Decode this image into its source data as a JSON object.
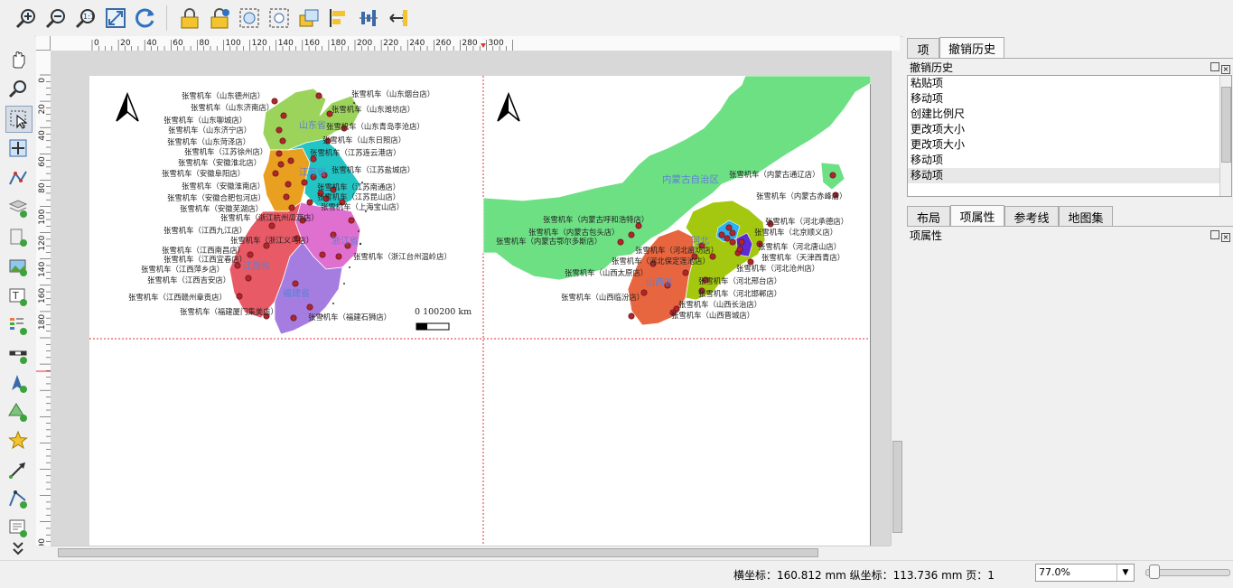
{
  "toolbar": {
    "icons": [
      "zoom-in-icon",
      "zoom-out-icon",
      "zoom-100-icon",
      "zoom-full-icon",
      "refresh-icon",
      "lock-icon",
      "unlock-icon",
      "group-icon",
      "ungroup-icon",
      "raise-icon",
      "align-icon",
      "distribute-icon",
      "resize-icon"
    ]
  },
  "lefttools": {
    "icons": [
      "pan-icon",
      "zoom-tool-icon",
      "select-icon",
      "move-content-icon",
      "edit-nodes-icon",
      "add-map-icon",
      "add-3d-map-icon",
      "add-picture-icon",
      "add-label-icon",
      "add-legend-icon",
      "add-scalebar-icon",
      "add-north-arrow-icon",
      "add-shape-icon",
      "add-marker-icon",
      "add-arrow-icon",
      "add-node-item-icon",
      "add-html-icon",
      "more-tools-icon"
    ]
  },
  "hruler": {
    "labels": [
      "0",
      "20",
      "40",
      "60",
      "80",
      "100",
      "120",
      "140",
      "160",
      "180",
      "200",
      "220",
      "240",
      "260",
      "280",
      "300"
    ]
  },
  "vruler": {
    "labels": [
      "0",
      "20",
      "40",
      "60",
      "80",
      "100",
      "120",
      "140",
      "160",
      "180",
      "190"
    ]
  },
  "maps": {
    "left": {
      "province_labels": [
        "山东省",
        "江苏省",
        "江西省",
        "浙江省",
        "福建省"
      ],
      "store_labels": [
        "张雪机车（山东德州店）",
        "张雪机车（山东烟台店）",
        "张雪机车（山东济南店）",
        "张雪机车（山东潍坊店）",
        "张雪机车（山东聊城店）",
        "张雪机车（山东青岛李沧店）",
        "张雪机车（山东济宁店）",
        "张雪机车（山东日照店）",
        "张雪机车（山东菏泽店）",
        "张雪机车（江苏徐州店）",
        "张雪机车（江苏连云港店）",
        "张雪机车（安徽淮北店）",
        "张雪机车（安徽阜阳店）",
        "张雪机车（江苏盐城店）",
        "张雪机车（安徽淮南店）",
        "张雪机车（江苏南通店）",
        "张雪机车（安徽合肥包河店）",
        "张雪机车（江苏昆山店）",
        "张雪机车（安徽芜湖店）",
        "张雪机车（上海宝山店）",
        "张雪机车（浙江杭州瓜沥店）",
        "张雪机车（江西九江店）",
        "张雪机车（浙江义乌店）",
        "张雪机车（江西南昌店）",
        "张雪机车（江西宜春店）",
        "张雪机车（浙江台州温岭店）",
        "张雪机车（江西萍乡店）",
        "张雪机车（江西吉安店）",
        "张雪机车（江西赣州章贡店）",
        "张雪机车（福建厦门集美店）",
        "张雪机车（福建石狮店）"
      ],
      "scale_text": "0  100200  km"
    },
    "right": {
      "province_labels": [
        "内蒙古自治区",
        "山西省",
        "河北"
      ],
      "store_labels": [
        "张雪机车（内蒙古通辽店）",
        "张雪机车（内蒙古赤峰店）",
        "张雪机车（河北承德店）",
        "张雪机车（内蒙古呼和浩特店）",
        "张雪机车（北京顺义店）",
        "张雪机车（内蒙古包头店）",
        "张雪机车（河北唐山店）",
        "张雪机车（内蒙古鄂尔多斯店）",
        "张雪机车（河北廊坊店）",
        "张雪机车（天津西青店）",
        "张雪机车（河北保定莲池店）",
        "张雪机车（河北沧州店）",
        "张雪机车（山西太原店）",
        "张雪机车（河北邢台店）",
        "张雪机车（河北邯郸店）",
        "张雪机车（山西临汾店）",
        "张雪机车（山西长治店）",
        "张雪机车（山西晋城店）"
      ]
    }
  },
  "rightpanel": {
    "top_tabs": [
      "项",
      "撤销历史"
    ],
    "history_title": "撤销历史",
    "history_items": [
      "粘贴项",
      "移动项",
      "创建比例尺",
      "更改项大小",
      "更改项大小",
      "移动项",
      "移动项"
    ],
    "bottom_tabs": [
      "布局",
      "项属性",
      "参考线",
      "地图集"
    ],
    "item_props_title": "项属性"
  },
  "status": {
    "coords": "横坐标：160.812 mm 纵坐标：113.736 mm 页：1",
    "zoom": "77.0%",
    "zoom_fraction": 0.05
  }
}
